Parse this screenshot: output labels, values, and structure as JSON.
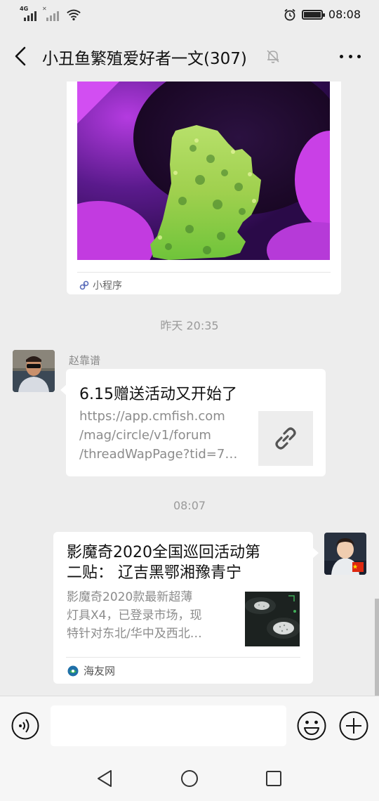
{
  "status_bar": {
    "network_label": "4G",
    "time": "08:08",
    "battery_level": 1.0,
    "icons": [
      "signal-icon",
      "wifi-icon",
      "alarm-icon",
      "battery-icon"
    ]
  },
  "header": {
    "title": "小丑鱼繁殖爱好者一文(307)",
    "back_icon": "chevron-left-icon",
    "mute_icon": "bell-off-icon",
    "more_icon": "more-dots-icon"
  },
  "messages": {
    "mini_program": {
      "label": "小程序",
      "image": "purple-coral-photo"
    },
    "timestamp_1": "昨天 20:35",
    "link_message": {
      "sender": "赵靠谱",
      "title": "6.15赠送活动又开始了",
      "url_lines": [
        "https://app.cmfish.com",
        "/mag/circle/v1/forum",
        "/threadWapPage?tid=7…"
      ],
      "thumb_icon": "link-icon"
    },
    "timestamp_2": "08:07",
    "article_message": {
      "title_lines": [
        "影魔奇2020全国巡回活动第",
        "二贴： 辽吉黑鄂湘豫青宁"
      ],
      "desc_lines": [
        "影魔奇2020款最新超薄",
        "灯具X4，已登录市场，现",
        "特针对东北/华中及西北…"
      ],
      "source": "海友网",
      "source_icon": "haiyou-logo-icon"
    }
  },
  "input_bar": {
    "value": "",
    "voice_icon": "voice-icon",
    "emoji_icon": "emoji-icon",
    "plus_icon": "plus-circle-icon"
  },
  "nav_bar": {
    "icons": [
      "nav-back-icon",
      "nav-home-icon",
      "nav-recent-icon"
    ]
  },
  "colors": {
    "background": "#ededed",
    "bubble": "#ffffff",
    "secondary_text": "#8c8c8c",
    "accent_purple": "#a22ad6"
  }
}
